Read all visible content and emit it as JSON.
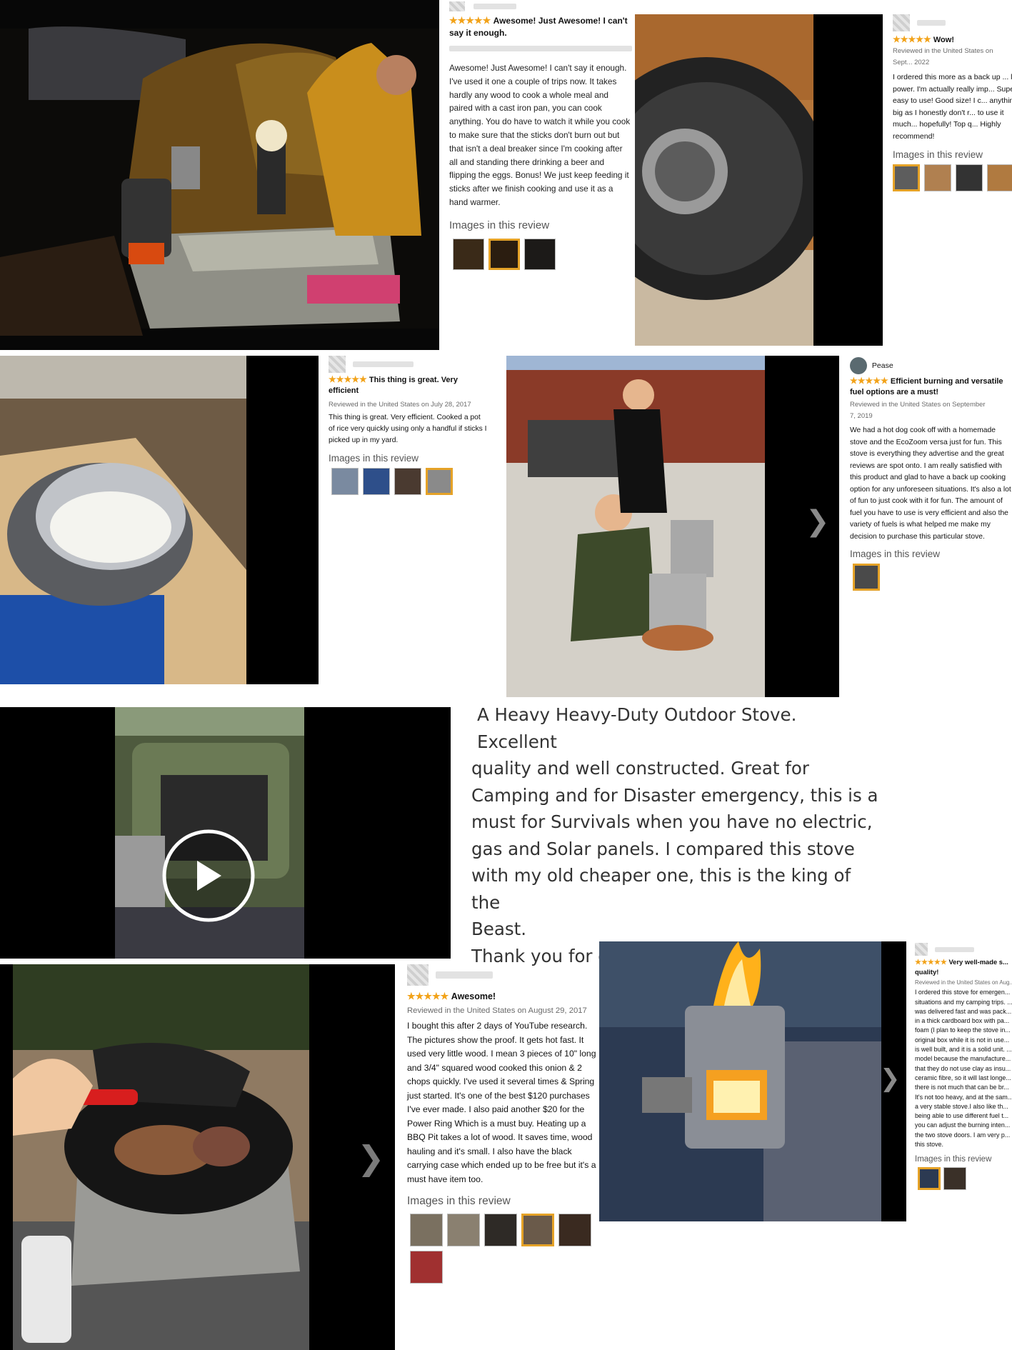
{
  "review1": {
    "stars": "★★★★★",
    "title": "Awesome! Just Awesome! I can't say it enough.",
    "body": "Awesome! Just Awesome! I can't say it enough. I've used it one a couple of trips now. It takes hardly any wood to cook a whole meal and paired with a cast iron pan, you can cook anything. You do have to watch it while you cook to make sure that the sticks don't burn out but that isn't a deal breaker since I'm cooking after all and standing there drinking a beer and flipping the eggs. Bonus! We just keep feeding it sticks after we finish cooking and use it as a hand warmer.",
    "images_label": "Images in this review"
  },
  "review2": {
    "stars": "★★★★★",
    "title": "Wow!",
    "meta": "Reviewed in the United States on Sept... 2022",
    "body": "I ordered this more as a back up ... lose power. I'm actually really imp... Super easy to use! Good size! I c... anything big as I honestly don't r... to use it much... hopefully! Top q... Highly recommend!",
    "images_label": "Images in this review"
  },
  "review3": {
    "stars": "★★★★★",
    "title": "This thing is great. Very efficient",
    "meta": "Reviewed in the United States on July 28, 2017",
    "body": "This thing is great. Very efficient. Cooked a pot of rice very quickly using only a handful if sticks I picked up in my yard.",
    "images_label": "Images in this review"
  },
  "review4": {
    "author": "Pease",
    "stars": "★★★★★",
    "title": "Efficient burning and versatile fuel options are a must!",
    "meta": "Reviewed in the United States on September 7, 2019",
    "body": "We had a hot dog cook off with a homemade stove and the EcoZoom versa just for fun. This stove is everything they advertise and the great reviews are spot onto. I am really satisfied with this product and glad to have a back up cooking option for any unforeseen situations. It's also a lot of fun to just cook with it for fun. The amount of fuel you have to use is very efficient and also the variety of fuels is what helped me make my decision to purchase this particular stove.",
    "images_label": "Images in this review"
  },
  "quote": {
    "lines": [
      "A Heavy Heavy-Duty Outdoor Stove. Excellent",
      "quality and well constructed. Great for",
      "Camping and for Disaster emergency, this is a",
      "must for Survivals when you have no electric,",
      "gas and Solar panels. I compared this stove",
      "with my old cheaper one, this is the king of the",
      "Beast.",
      "Thank you for dropping by."
    ]
  },
  "review5": {
    "stars": "★★★★★",
    "title": "Awesome!",
    "meta": "Reviewed in the United States on August 29, 2017",
    "body": "I bought this after 2 days of YouTube research. The pictures show the proof. It gets hot fast. It used very little wood. I mean 3 pieces of 10\" long and 3/4\" squared wood cooked this onion & 2 chops quickly. I've used it several times & Spring just started. It's one of the best $120 purchases I've ever made. I also paid another $20 for the Power Ring Which is a must buy. Heating up a BBQ Pit takes a lot of wood. It saves time, wood hauling and it's small. I also have the black carrying case which ended up to be free but it's a must have item too.",
    "images_label": "Images in this review"
  },
  "review6": {
    "stars": "★★★★★",
    "title": "Very well-made s... quality!",
    "meta": "Reviewed in the United States on Aug...",
    "body": "I ordered this stove for emergen... situations and my camping trips. ... was delivered fast and was pack... in a thick cardboard box with pa... foam (I plan to keep the stove in... original box while it is not in use... is well built, and it is a solid unit. ... model because the manufacture... that they do not use clay as insu... ceramic fibre, so it will last longe... there is not much that can be br... It's not too heavy, and at the sam... a very stable stove.I also like th... being able to use different fuel t... you can adjust the burning inten... the two stove doors. I am very p... this stove.",
    "images_label": "Images in this review"
  },
  "icons": {
    "play": "play-icon",
    "next": "chevron-right-icon",
    "next_glyph": "❯"
  },
  "colors": {
    "star": "#f2a218",
    "selected_thumb": "#e5a227",
    "background": "#ffffff"
  }
}
